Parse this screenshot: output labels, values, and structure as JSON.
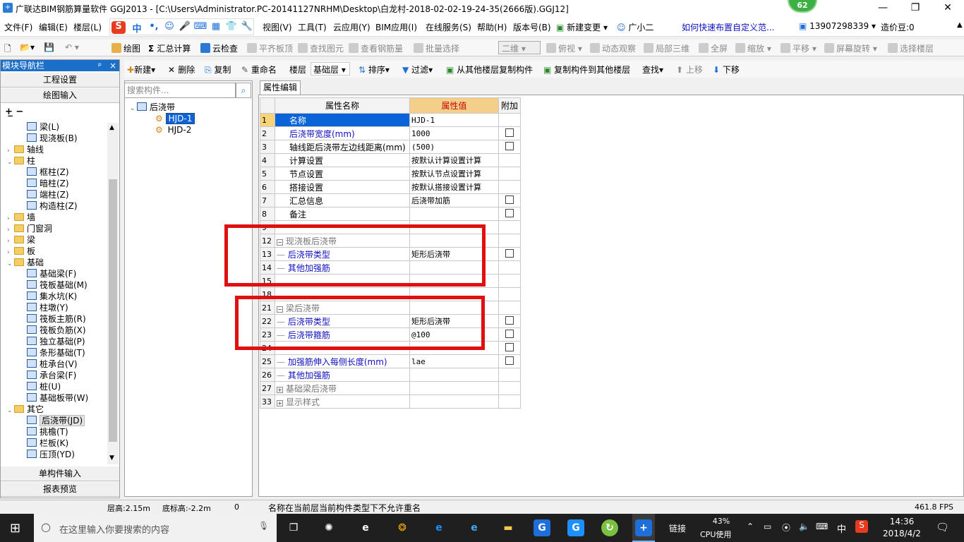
{
  "window": {
    "title": "广联达BIM钢筋算量软件 GGJ2013 - [C:\\Users\\Administrator.PC-20141127NRHM\\Desktop\\白龙村-2018-02-02-19-24-35(2666版).GGJ12]",
    "score": "62"
  },
  "menu": {
    "items": [
      "文件(F)",
      "编辑(E)",
      "楼层(L)",
      "视图(V)",
      "工具(T)",
      "云应用(Y)",
      "BIM应用(I)",
      "在线服务(S)",
      "帮助(H)",
      "版本号(B)"
    ],
    "new_change": "新建变更",
    "assistant": "广小二",
    "help_link": "如何快速布置自定义范...",
    "phone": "13907298339",
    "price_bean": "造价豆:0"
  },
  "ime": {
    "mode": "中"
  },
  "toolbar": {
    "draw": "绘图",
    "sum_calc": "汇总计算",
    "cloud_check": "云检查",
    "flush_top": "平齐板顶",
    "find_element": "查找图元",
    "view_steel": "查看钢筋量",
    "batch_select": "批量选择",
    "view_mode": "二维",
    "top_view": "俯视",
    "dynamic_view": "动态观察",
    "local_3d": "局部三维",
    "fullscreen": "全屏",
    "zoom": "缩放",
    "pan": "平移",
    "rotate": "屏幕旋转",
    "select_floor": "选择楼层"
  },
  "toolbar2": {
    "new": "新建",
    "delete": "删除",
    "copy": "复制",
    "rename": "重命名",
    "floor_label": "楼层",
    "floor_value": "基础层",
    "sort": "排序",
    "filter": "过滤",
    "copy_from": "从其他楼层复制构件",
    "copy_to": "复制构件到其他楼层",
    "find": "查找",
    "move_up": "上移",
    "move_down": "下移"
  },
  "sidebar": {
    "header": "模块导航栏",
    "project_settings": "工程设置",
    "drawing_input": "绘图输入",
    "single_input": "单构件输入",
    "report_preview": "报表预览",
    "tree": [
      {
        "label": "梁(L)",
        "level": 2,
        "kind": "leaf"
      },
      {
        "label": "现浇板(B)",
        "level": 2,
        "kind": "leaf"
      },
      {
        "label": "轴线",
        "level": 1,
        "kind": "folder",
        "expand": "›"
      },
      {
        "label": "柱",
        "level": 1,
        "kind": "folder",
        "expand": "⌄"
      },
      {
        "label": "框柱(Z)",
        "level": 2,
        "kind": "leaf"
      },
      {
        "label": "暗柱(Z)",
        "level": 2,
        "kind": "leaf"
      },
      {
        "label": "端柱(Z)",
        "level": 2,
        "kind": "leaf"
      },
      {
        "label": "构造柱(Z)",
        "level": 2,
        "kind": "leaf"
      },
      {
        "label": "墙",
        "level": 1,
        "kind": "folder",
        "expand": "›"
      },
      {
        "label": "门窗洞",
        "level": 1,
        "kind": "folder",
        "expand": "›"
      },
      {
        "label": "梁",
        "level": 1,
        "kind": "folder",
        "expand": "›"
      },
      {
        "label": "板",
        "level": 1,
        "kind": "folder",
        "expand": "›"
      },
      {
        "label": "基础",
        "level": 1,
        "kind": "folder",
        "expand": "⌄"
      },
      {
        "label": "基础梁(F)",
        "level": 2,
        "kind": "leaf"
      },
      {
        "label": "筏板基础(M)",
        "level": 2,
        "kind": "leaf"
      },
      {
        "label": "集水坑(K)",
        "level": 2,
        "kind": "leaf"
      },
      {
        "label": "柱墩(Y)",
        "level": 2,
        "kind": "leaf"
      },
      {
        "label": "筏板主筋(R)",
        "level": 2,
        "kind": "leaf"
      },
      {
        "label": "筏板负筋(X)",
        "level": 2,
        "kind": "leaf"
      },
      {
        "label": "独立基础(P)",
        "level": 2,
        "kind": "leaf"
      },
      {
        "label": "条形基础(T)",
        "level": 2,
        "kind": "leaf"
      },
      {
        "label": "桩承台(V)",
        "level": 2,
        "kind": "leaf"
      },
      {
        "label": "承台梁(F)",
        "level": 2,
        "kind": "leaf"
      },
      {
        "label": "桩(U)",
        "level": 2,
        "kind": "leaf"
      },
      {
        "label": "基础板带(W)",
        "level": 2,
        "kind": "leaf"
      },
      {
        "label": "其它",
        "level": 1,
        "kind": "folder",
        "expand": "⌄"
      },
      {
        "label": "后浇带(JD)",
        "level": 2,
        "kind": "leaf",
        "selected": true
      },
      {
        "label": "挑檐(T)",
        "level": 2,
        "kind": "leaf"
      },
      {
        "label": "栏板(K)",
        "level": 2,
        "kind": "leaf"
      },
      {
        "label": "压顶(YD)",
        "level": 2,
        "kind": "leaf"
      }
    ]
  },
  "component_panel": {
    "search_placeholder": "搜索构件...",
    "root": "后浇带",
    "items": [
      "HJD-1",
      "HJD-2"
    ]
  },
  "props": {
    "tab": "属性编辑",
    "headers": [
      "属性名称",
      "属性值",
      "附加"
    ],
    "rows": [
      {
        "num": "1",
        "name": "名称",
        "value": "HJD-1",
        "check": false,
        "style": "selected"
      },
      {
        "num": "2",
        "name": "后浇带宽度(mm)",
        "value": "1000",
        "check": true,
        "style": "blue"
      },
      {
        "num": "3",
        "name": "轴线距后浇带左边线距离(mm)",
        "value": "(500)",
        "check": true,
        "style": "normal"
      },
      {
        "num": "4",
        "name": "计算设置",
        "value": "按默认计算设置计算",
        "check": false,
        "style": "normal"
      },
      {
        "num": "5",
        "name": "节点设置",
        "value": "按默认节点设置计算",
        "check": false,
        "style": "normal"
      },
      {
        "num": "6",
        "name": "搭接设置",
        "value": "按默认搭接设置计算",
        "check": false,
        "style": "normal"
      },
      {
        "num": "7",
        "name": "汇总信息",
        "value": "后浇带加筋",
        "check": true,
        "style": "normal"
      },
      {
        "num": "8",
        "name": "备注",
        "value": "",
        "check": true,
        "style": "normal"
      },
      {
        "num": "9",
        "name": "",
        "value": "",
        "check": false,
        "style": "hidden"
      },
      {
        "num": "12",
        "name": "现浇板后浇带",
        "value": "",
        "check": false,
        "style": "group"
      },
      {
        "num": "13",
        "name": "后浇带类型",
        "value": "矩形后浇带",
        "check": true,
        "style": "child"
      },
      {
        "num": "14",
        "name": "其他加强筋",
        "value": "",
        "check": false,
        "style": "child"
      },
      {
        "num": "15",
        "name": "",
        "value": "",
        "check": false,
        "style": "hidden"
      },
      {
        "num": "18",
        "name": "",
        "value": "",
        "check": false,
        "style": "hidden"
      },
      {
        "num": "21",
        "name": "梁后浇带",
        "value": "",
        "check": false,
        "style": "group"
      },
      {
        "num": "22",
        "name": "后浇带类型",
        "value": "矩形后浇带",
        "check": true,
        "style": "child"
      },
      {
        "num": "23",
        "name": "后浇带箍筋",
        "value": "@100",
        "check": true,
        "style": "child"
      },
      {
        "num": "24",
        "name": "",
        "value": "",
        "check": true,
        "style": "hidden"
      },
      {
        "num": "25",
        "name": "加强筋伸入每侧长度(mm)",
        "value": "lae",
        "check": true,
        "style": "child"
      },
      {
        "num": "26",
        "name": "其他加强筋",
        "value": "",
        "check": false,
        "style": "child"
      },
      {
        "num": "27",
        "name": "基础梁后浇带",
        "value": "",
        "check": false,
        "style": "collapsed"
      },
      {
        "num": "33",
        "name": "显示样式",
        "value": "",
        "check": false,
        "style": "collapsed"
      }
    ]
  },
  "status": {
    "floor_height": "层高:2.15m",
    "bottom_height": "底标高:-2.2m",
    "count": "0",
    "message": "名称在当前层当前构件类型下不允许重名",
    "fps": "461.8 FPS"
  },
  "taskbar": {
    "search_placeholder": "在这里输入你要搜索的内容",
    "link": "链接",
    "cpu_percent": "43%",
    "cpu_label": "CPU使用",
    "ime": "中",
    "time": "14:36",
    "date": "2018/4/2"
  },
  "colors": {
    "accent": "#1c6fc9",
    "highlight_box": "#e01010",
    "value_header": "#f3cf8a"
  }
}
